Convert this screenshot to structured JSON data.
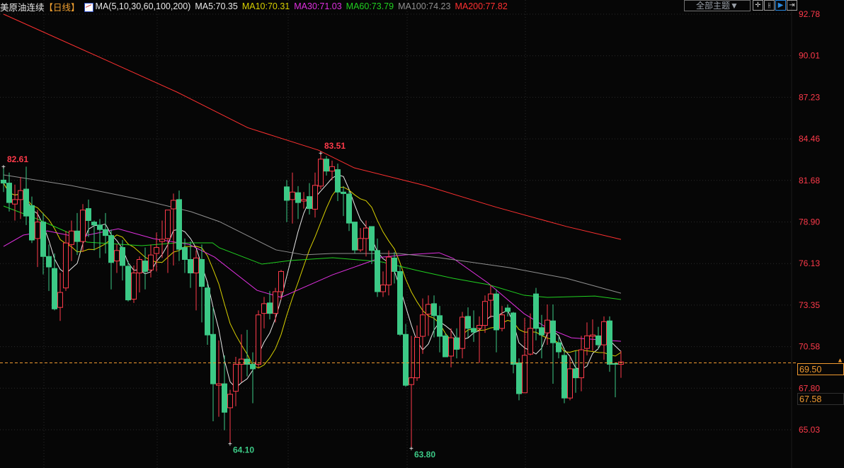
{
  "header": {
    "instrument": "美原油连续",
    "period": "【日线】",
    "ma_icon": "ma-chart-icon",
    "ma_params": "MA(5,10,30,60,100,200)",
    "ma_values": [
      {
        "label": "MA5:70.35",
        "color": "#e8e8e8"
      },
      {
        "label": "MA10:70.31",
        "color": "#d8d000"
      },
      {
        "label": "MA30:71.03",
        "color": "#e030e0"
      },
      {
        "label": "MA60:73.79",
        "color": "#20d020"
      },
      {
        "label": "MA100:74.23",
        "color": "#909090"
      },
      {
        "label": "MA200:77.82",
        "color": "#ff3030"
      }
    ],
    "theme_select": "全部主题▼",
    "toolbar": [
      "crosshair-icon",
      "range-icon",
      "play-icon",
      "move-right-icon"
    ]
  },
  "price_boxes": {
    "current": "69.50",
    "other": "67.58"
  },
  "chart_data": {
    "type": "candlestick",
    "ylim": [
      65.03,
      92.78
    ],
    "yticks": [
      "92.78",
      "90.01",
      "87.23",
      "84.46",
      "81.68",
      "78.90",
      "76.13",
      "73.35",
      "70.58",
      "67.80",
      "65.03"
    ],
    "colors": {
      "up": "#ff3b4b",
      "down": "#3cc986",
      "current_line": "#f09a30"
    },
    "current_price": 69.5,
    "annotations": [
      {
        "text": "82.61",
        "index": 0,
        "price": 82.61,
        "type": "high"
      },
      {
        "text": "83.51",
        "index": 56,
        "price": 83.51,
        "type": "high"
      },
      {
        "text": "64.10",
        "index": 40,
        "price": 64.1,
        "type": "low"
      },
      {
        "text": "63.80",
        "index": 72,
        "price": 63.8,
        "type": "low"
      }
    ],
    "ohlc": [
      [
        81.7,
        81.5,
        82.61,
        80.9
      ],
      [
        81.5,
        80.2,
        82.2,
        79.6
      ],
      [
        80.1,
        80.4,
        81.4,
        79.0
      ],
      [
        80.4,
        81.0,
        81.9,
        79.1
      ],
      [
        81.1,
        79.3,
        82.6,
        78.7
      ],
      [
        80.0,
        77.7,
        80.6,
        77.5
      ],
      [
        77.8,
        78.9,
        79.7,
        75.9
      ],
      [
        78.9,
        76.6,
        79.5,
        75.4
      ],
      [
        76.6,
        75.9,
        77.4,
        74.3
      ],
      [
        75.8,
        73.1,
        76.8,
        73.0
      ],
      [
        73.2,
        74.2,
        75.5,
        72.3
      ],
      [
        74.5,
        77.5,
        78.3,
        74.3
      ],
      [
        77.4,
        78.3,
        79.0,
        76.3
      ],
      [
        78.3,
        77.6,
        79.5,
        76.7
      ],
      [
        77.6,
        79.7,
        80.1,
        76.9
      ],
      [
        79.8,
        79.0,
        80.4,
        77.9
      ],
      [
        78.9,
        78.7,
        79.0,
        77.0
      ],
      [
        78.7,
        78.4,
        79.1,
        76.5
      ],
      [
        78.4,
        78.0,
        79.5,
        76.8
      ],
      [
        78.0,
        76.2,
        78.4,
        74.4
      ],
      [
        76.3,
        77.0,
        77.4,
        75.5
      ],
      [
        77.2,
        76.0,
        77.7,
        75.0
      ],
      [
        75.95,
        73.7,
        76.3,
        73.6
      ],
      [
        73.75,
        75.5,
        76.0,
        73.5
      ],
      [
        75.5,
        76.4,
        76.6,
        74.2
      ],
      [
        76.3,
        75.6,
        77.2,
        74.4
      ],
      [
        75.7,
        76.7,
        77.4,
        75.2
      ],
      [
        76.8,
        77.2,
        78.2,
        75.6
      ],
      [
        77.6,
        77.75,
        79.0,
        76.5
      ],
      [
        77.8,
        79.7,
        79.7,
        75.5
      ],
      [
        79.78,
        80.35,
        80.8,
        76.0
      ],
      [
        80.4,
        77.08,
        81.0,
        76.3
      ],
      [
        77.2,
        76.4,
        77.8,
        75.5
      ],
      [
        76.4,
        75.5,
        77.6,
        74.5
      ],
      [
        75.5,
        76.5,
        77.0,
        73.0
      ],
      [
        76.4,
        74.6,
        77.4,
        72.2
      ],
      [
        74.5,
        71.36,
        74.8,
        70.7
      ],
      [
        71.4,
        68.1,
        73.2,
        65.6
      ],
      [
        68.0,
        68.1,
        71.0,
        65.9
      ],
      [
        68.1,
        66.2,
        70.0,
        65.0
      ],
      [
        66.5,
        67.4,
        67.7,
        64.1
      ],
      [
        67.6,
        69.4,
        69.9,
        66.6
      ],
      [
        69.4,
        69.75,
        71.4,
        68.2
      ],
      [
        69.75,
        69.4,
        71.7,
        68.6
      ],
      [
        69.4,
        69.1,
        70.2,
        66.8
      ],
      [
        69.4,
        72.7,
        73.0,
        69.2
      ],
      [
        72.8,
        73.45,
        73.9,
        71.8
      ],
      [
        73.5,
        72.8,
        74.3,
        72.4
      ],
      [
        72.8,
        74.25,
        74.5,
        72.2
      ],
      [
        74.25,
        75.6,
        75.7,
        73.7
      ],
      [
        81.25,
        80.35,
        81.7,
        78.9
      ],
      [
        80.4,
        80.9,
        82.2,
        78.8
      ],
      [
        80.86,
        80.2,
        81.3,
        79.1
      ],
      [
        80.3,
        80.4,
        80.9,
        79.8
      ],
      [
        80.6,
        79.8,
        81.5,
        79.4
      ],
      [
        79.76,
        81.35,
        82.2,
        79.2
      ],
      [
        81.3,
        83.1,
        83.51,
        81.1
      ],
      [
        83.1,
        82.3,
        83.3,
        82.0
      ],
      [
        82.3,
        82.6,
        83.0,
        81.7
      ],
      [
        82.4,
        80.9,
        82.8,
        80.3
      ],
      [
        80.9,
        80.8,
        81.3,
        79.3
      ],
      [
        80.77,
        78.83,
        81.0,
        78.3
      ],
      [
        78.9,
        77.03,
        78.9,
        76.8
      ],
      [
        77.04,
        77.8,
        78.5,
        76.9
      ],
      [
        77.8,
        78.5,
        79.0,
        76.6
      ],
      [
        78.6,
        77.0,
        78.6,
        76.1
      ],
      [
        77.0,
        74.25,
        77.8,
        73.9
      ],
      [
        74.25,
        74.7,
        75.6,
        73.9
      ],
      [
        74.7,
        76.56,
        77.0,
        74.0
      ],
      [
        76.5,
        75.6,
        76.9,
        74.8
      ],
      [
        75.6,
        71.4,
        76.0,
        71.3
      ],
      [
        71.4,
        68.0,
        72.1,
        67.9
      ],
      [
        68.05,
        68.5,
        71.3,
        63.8
      ],
      [
        68.5,
        71.2,
        72.0,
        68.3
      ],
      [
        71.27,
        72.7,
        73.8,
        70.1
      ],
      [
        72.75,
        73.4,
        74.0,
        71.3
      ],
      [
        73.45,
        72.65,
        74.0,
        71.2
      ],
      [
        72.65,
        71.27,
        73.3,
        70.2
      ],
      [
        71.3,
        69.9,
        71.5,
        69.9
      ],
      [
        69.95,
        71.17,
        71.8,
        69.2
      ],
      [
        71.17,
        70.4,
        71.8,
        69.8
      ],
      [
        70.46,
        72.55,
        72.9,
        69.8
      ],
      [
        72.6,
        71.8,
        73.2,
        71.2
      ],
      [
        71.8,
        71.55,
        73.0,
        70.9
      ],
      [
        71.8,
        72.0,
        72.6,
        69.5
      ],
      [
        72.0,
        73.6,
        74.0,
        71.5
      ],
      [
        73.68,
        74.1,
        74.7,
        72.5
      ],
      [
        74.1,
        71.7,
        74.4,
        70.2
      ],
      [
        71.8,
        72.7,
        73.3,
        71.6
      ],
      [
        73.16,
        72.93,
        73.4,
        72.6
      ],
      [
        72.83,
        69.4,
        72.9,
        68.8
      ],
      [
        69.5,
        67.44,
        69.8,
        67.0
      ],
      [
        67.5,
        70.0,
        72.5,
        67.5
      ],
      [
        70.08,
        71.8,
        72.8,
        70.0
      ],
      [
        74.1,
        71.8,
        74.5,
        71.0
      ],
      [
        71.85,
        71.36,
        72.7,
        69.8
      ],
      [
        71.5,
        72.35,
        73.4,
        70.7
      ],
      [
        72.3,
        70.84,
        73.4,
        68.1
      ],
      [
        70.84,
        70.23,
        71.2,
        69.8
      ],
      [
        70.0,
        67.15,
        70.5,
        66.8
      ],
      [
        67.15,
        69.1,
        69.9,
        67.0
      ],
      [
        69.1,
        68.5,
        70.3,
        67.5
      ],
      [
        68.5,
        70.37,
        71.3,
        67.6
      ],
      [
        70.46,
        71.3,
        72.2,
        70.0
      ],
      [
        71.27,
        71.36,
        72.4,
        70.3
      ],
      [
        71.3,
        70.7,
        71.9,
        70.4
      ],
      [
        70.7,
        72.25,
        72.6,
        69.7
      ],
      [
        72.3,
        69.4,
        72.6,
        68.9
      ],
      [
        69.45,
        69.4,
        69.5,
        67.2
      ],
      [
        69.4,
        69.56,
        70.3,
        68.5
      ]
    ],
    "ma_lines": [
      {
        "name": "MA5",
        "period": 5,
        "color": "#e8e8e8"
      },
      {
        "name": "MA10",
        "period": 10,
        "color": "#d8d000"
      },
      {
        "name": "MA30",
        "color": "#e030e0",
        "points": [
          [
            0,
            77.27
          ],
          [
            3.5,
            78.03
          ],
          [
            7.75,
            78.31
          ],
          [
            13.1,
            77.89
          ],
          [
            20.25,
            78.45
          ],
          [
            26.5,
            77.79
          ],
          [
            32.75,
            77.41
          ],
          [
            37.25,
            76.56
          ],
          [
            44.75,
            74.34
          ],
          [
            49,
            73.87
          ],
          [
            58.1,
            75.38
          ],
          [
            62,
            75.9
          ],
          [
            66.9,
            76.56
          ],
          [
            71,
            76.71
          ],
          [
            76.9,
            76.85
          ],
          [
            79.4,
            76.47
          ],
          [
            85.6,
            74.81
          ],
          [
            91.9,
            72.78
          ],
          [
            96,
            71.83
          ],
          [
            100.25,
            71.17
          ],
          [
            109,
            70.94
          ]
        ]
      },
      {
        "name": "MA60",
        "color": "#20d020",
        "points": [
          [
            0,
            79.97
          ],
          [
            5.6,
            79.16
          ],
          [
            11.9,
            78.12
          ],
          [
            14.75,
            77.56
          ],
          [
            24.4,
            77.32
          ],
          [
            30.6,
            77.51
          ],
          [
            36.9,
            77.51
          ],
          [
            38.1,
            77.18
          ],
          [
            45.6,
            76.09
          ],
          [
            50.6,
            76.33
          ],
          [
            58.1,
            76.52
          ],
          [
            65.6,
            76.28
          ],
          [
            66.9,
            76.23
          ],
          [
            73.1,
            75.66
          ],
          [
            79.4,
            75.14
          ],
          [
            85.6,
            74.72
          ],
          [
            91.9,
            74.01
          ],
          [
            96,
            73.87
          ],
          [
            104.4,
            73.96
          ],
          [
            109,
            73.73
          ]
        ]
      },
      {
        "name": "MA100",
        "color": "#909090",
        "points": [
          [
            0,
            82.05
          ],
          [
            11.9,
            81.34
          ],
          [
            24.4,
            80.39
          ],
          [
            33.1,
            79.59
          ],
          [
            38.1,
            78.93
          ],
          [
            48.1,
            77.04
          ],
          [
            53.1,
            76.71
          ],
          [
            58.1,
            76.8
          ],
          [
            69.75,
            76.8
          ],
          [
            76.9,
            76.52
          ],
          [
            89.4,
            75.85
          ],
          [
            99.4,
            75.14
          ],
          [
            109,
            74.15
          ]
        ]
      },
      {
        "name": "MA200",
        "color": "#ff3030",
        "points": [
          [
            0,
            92.78
          ],
          [
            18.1,
            89.71
          ],
          [
            30.6,
            87.58
          ],
          [
            43.1,
            85.2
          ],
          [
            55.6,
            83.7
          ],
          [
            61.9,
            82.52
          ],
          [
            74.4,
            81.34
          ],
          [
            86.9,
            79.9
          ],
          [
            99.4,
            78.6
          ],
          [
            109,
            77.74
          ]
        ]
      }
    ]
  }
}
